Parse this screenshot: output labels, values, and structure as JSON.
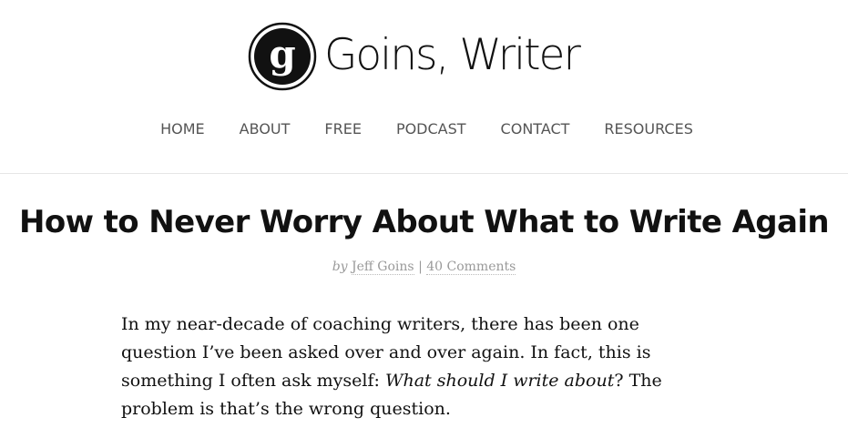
{
  "site": {
    "logo_letter": "g",
    "name": "Goins, Writer"
  },
  "nav": {
    "items": [
      {
        "label": "HOME"
      },
      {
        "label": "ABOUT"
      },
      {
        "label": "FREE"
      },
      {
        "label": "PODCAST"
      },
      {
        "label": "CONTACT"
      },
      {
        "label": "RESOURCES"
      }
    ]
  },
  "post": {
    "title": "How to Never Worry About What to Write Again",
    "byline": {
      "by": "by",
      "author": "Jeff Goins",
      "separator": "|",
      "comments": "40 Comments"
    },
    "intro": {
      "text_before": "In my near-decade of coaching writers, there has been one question I’ve been asked over and over again. In fact, this is something I often ask myself: ",
      "emphasis": "What should I write about",
      "text_after": "? The problem is that’s the wrong question."
    }
  },
  "colors": {
    "logo": "#111111",
    "nav_text": "#555555",
    "byline_text": "#999999",
    "divider": "#e6e6e6"
  }
}
